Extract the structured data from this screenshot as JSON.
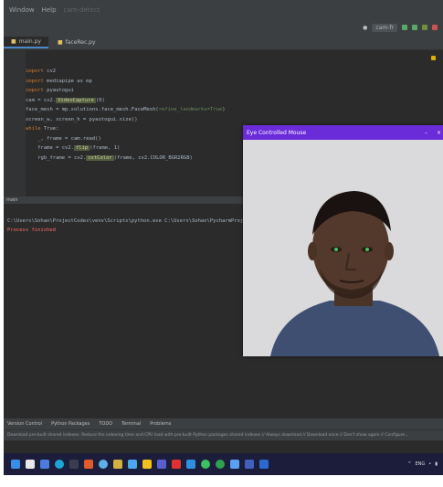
{
  "menubar": {
    "items": [
      "Window",
      "Help"
    ],
    "muted_title": "cam-detect"
  },
  "toolbar": {
    "run_config": "cam-fr"
  },
  "tabs": [
    {
      "label": "main.py"
    },
    {
      "label": "faceRec.py"
    }
  ],
  "editor": {
    "lines": [
      {
        "kw": "import",
        "rest": " cv2"
      },
      {
        "kw": "import",
        "rest": " mediapipe as mp"
      },
      {
        "kw": "import",
        "rest": " pyautogui"
      },
      {
        "kw": "",
        "rest": "cam = cv2.",
        "hl": "VideoCapture",
        "tail": "(0)"
      },
      {
        "kw": "",
        "rest": "face_mesh = mp.solutions.face_mesh.FaceMesh(",
        "str": "refine_landmarks=True",
        "tail": ")"
      },
      {
        "kw": "",
        "rest": "screen_w, screen_h = pyautogui.size()"
      },
      {
        "kw": "while",
        "rest": " True:"
      },
      {
        "kw": "",
        "rest": "    _, frame = cam.read()"
      },
      {
        "kw": "",
        "rest": "    frame = cv2.",
        "hl": "flip",
        "tail": "(frame, 1)"
      },
      {
        "kw": "",
        "rest": "    rgb_frame = cv2.",
        "hl": "cvtColor",
        "tail": "(frame, cv2.COLOR_BGR2RGB)"
      }
    ]
  },
  "panel": {
    "label": "main"
  },
  "console": {
    "command": "C:\\Users\\Sohan\\ProjectCodes\\venv\\Scripts\\python.exe C:\\Users\\Sohan\\PycharmProjects\\pythonProject\\main.py",
    "error": "Process finished"
  },
  "bottom_tools": [
    "Version Control",
    "Python Packages",
    "TODO",
    "Terminal",
    "Problems"
  ],
  "statusbar": "Download pre-built shared indexes: Reduce the indexing time and CPU load with pre-built Python packages shared indexes // Always download // Download once // Don't show again // Configure...",
  "camera_window": {
    "title": "Eye Controlled Mouse",
    "minimize": "–",
    "close": "×"
  },
  "taskbar": {
    "icons": [
      "start",
      "search",
      "widgets",
      "edge",
      "explorer",
      "store",
      "chrome",
      "settings",
      "pycharm",
      "vlc",
      "teams",
      "youtube",
      "vscode",
      "whatsapp",
      "spotify",
      "photos",
      "camera",
      "mail"
    ],
    "tray_text": "ENG"
  },
  "colors": {
    "accent": "#6a2bd9",
    "editor_bg": "#2b2b2b",
    "keyword": "#cc7832"
  }
}
